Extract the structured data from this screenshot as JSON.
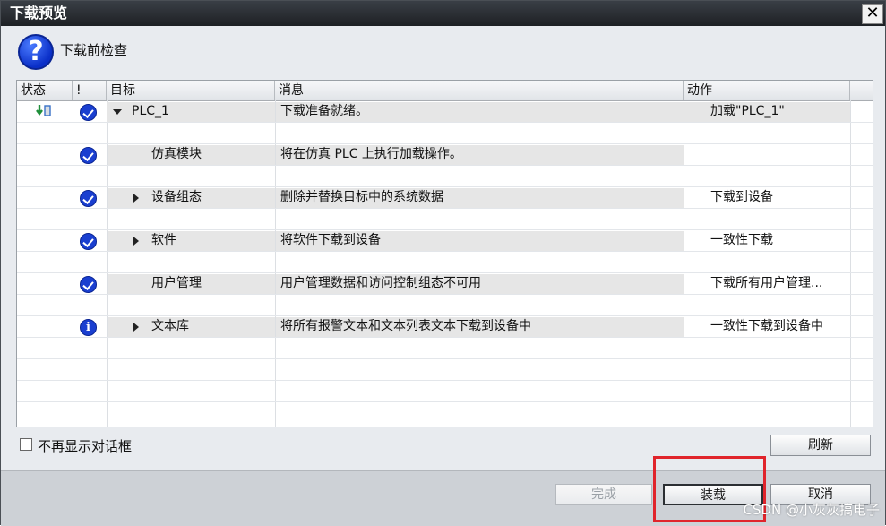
{
  "dialog": {
    "title": "下载预览",
    "close_label": "✕",
    "heading": "下载前检查"
  },
  "table": {
    "columns": {
      "status": "状态",
      "flag": "!",
      "target": "目标",
      "message": "消息",
      "action": "动作"
    },
    "rows": [
      {
        "status_icon": "download-status-icon",
        "icon": "check-icon",
        "expander": "expanded",
        "target": "PLC_1",
        "message": "下载准备就绪。",
        "action": "加载\"PLC_1\""
      },
      {
        "status_icon": "",
        "icon": "check-icon",
        "expander": "none",
        "target": "仿真模块",
        "message": "将在仿真 PLC 上执行加载操作。",
        "action": ""
      },
      {
        "status_icon": "",
        "icon": "check-icon",
        "expander": "collapsed",
        "target": "设备组态",
        "message": "删除并替换目标中的系统数据",
        "action": "下载到设备"
      },
      {
        "status_icon": "",
        "icon": "check-icon",
        "expander": "collapsed",
        "target": "软件",
        "message": "将软件下载到设备",
        "action": "一致性下载"
      },
      {
        "status_icon": "",
        "icon": "check-icon",
        "expander": "none",
        "target": "用户管理",
        "message": "用户管理数据和访问控制组态不可用",
        "action": "下载所有用户管理..."
      },
      {
        "status_icon": "",
        "icon": "info-icon",
        "expander": "collapsed",
        "target": "文本库",
        "message": "将所有报警文本和文本列表文本下载到设备中",
        "action": "一致性下载到设备中"
      }
    ]
  },
  "options": {
    "dont_show_label": "不再显示对话框",
    "dont_show_checked": false
  },
  "buttons": {
    "refresh": "刷新",
    "finish": "完成",
    "load": "装载",
    "cancel": "取消"
  },
  "watermark": "CSDN @小灰灰搞电子",
  "colors": {
    "icon_blue": "#1a3fd0",
    "highlight_red": "#e0242b",
    "title_bar": "#1d2024"
  }
}
